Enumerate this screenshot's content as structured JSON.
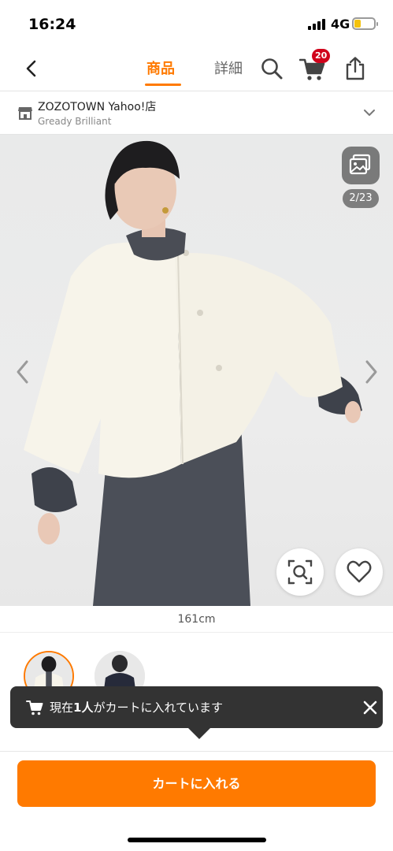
{
  "status_bar": {
    "time": "16:24",
    "network": "4G",
    "battery_level": 0.35
  },
  "header": {
    "tabs": [
      {
        "label": "商品",
        "active": true
      },
      {
        "label": "詳細",
        "active": false
      }
    ],
    "cart_count": "20",
    "accent_color": "#ff7a00",
    "icons": [
      "back-chevron-icon",
      "search-icon",
      "cart-icon",
      "share-icon"
    ]
  },
  "shop": {
    "name": "ZOZOTOWN Yahoo!店",
    "brand": "Gready Brilliant"
  },
  "gallery": {
    "counter": "2/23",
    "model_height": "161cm"
  },
  "toast": {
    "prefix": "現在",
    "count": "1人",
    "suffix": "がカートに入れています"
  },
  "cta": {
    "label": "カートに入れる",
    "color": "#ff7a00"
  }
}
